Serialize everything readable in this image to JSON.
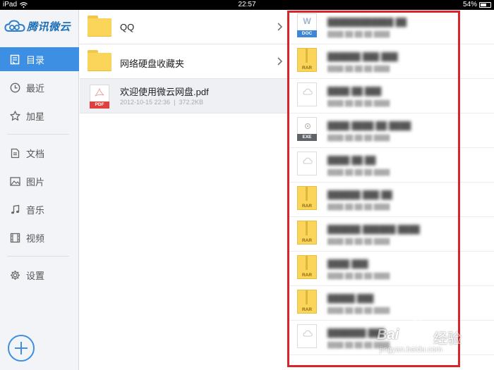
{
  "status_bar": {
    "carrier": "iPad",
    "time": "22:57",
    "battery": "54%"
  },
  "sidebar": {
    "logo_text": "腾讯微云",
    "items": [
      {
        "label": "目录",
        "icon": "directory-icon",
        "active": true
      },
      {
        "label": "最近",
        "icon": "clock-icon"
      },
      {
        "label": "加星",
        "icon": "star-icon"
      },
      {
        "label": "文档",
        "icon": "document-icon"
      },
      {
        "label": "图片",
        "icon": "image-icon"
      },
      {
        "label": "音乐",
        "icon": "music-icon"
      },
      {
        "label": "视频",
        "icon": "video-icon"
      },
      {
        "label": "设置",
        "icon": "gear-icon"
      }
    ]
  },
  "files": [
    {
      "name": "QQ",
      "type": "folder"
    },
    {
      "name": "网络硬盘收藏夹",
      "type": "folder"
    },
    {
      "name": "欢迎使用微云网盘.pdf",
      "type": "pdf",
      "date": "2012-10-15 22:36",
      "size": "372.2KB",
      "badge": "PDF",
      "meta_separator": "|"
    }
  ],
  "right_panel_icons": [
    {
      "kind": "doc",
      "badge": "DOC",
      "glyph": "W"
    },
    {
      "kind": "rar",
      "badge": "RAR"
    },
    {
      "kind": "cloud"
    },
    {
      "kind": "exe",
      "badge": "EXE"
    },
    {
      "kind": "cloud"
    },
    {
      "kind": "rar",
      "badge": "RAR"
    },
    {
      "kind": "rar",
      "badge": "RAR"
    },
    {
      "kind": "rar",
      "badge": "RAR"
    },
    {
      "kind": "rar",
      "badge": "RAR"
    },
    {
      "kind": "cloud"
    }
  ],
  "watermark": {
    "brand_latin": "Bai",
    "brand_cn": "经验",
    "url": "jingyan.baidu.com"
  },
  "colors": {
    "accent": "#3c8fe3",
    "highlight_box": "#d6262a",
    "folder": "#fbd55a"
  }
}
